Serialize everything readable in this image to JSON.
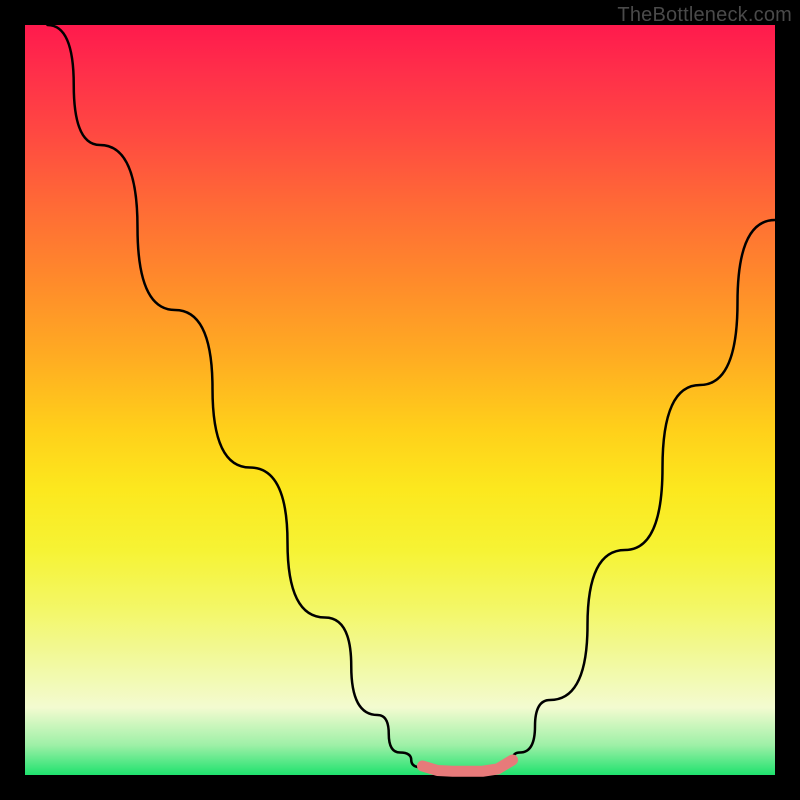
{
  "watermark": "TheBottleneck.com",
  "colors": {
    "background": "#000000",
    "curve": "#000000",
    "highlight": "#e77a7a",
    "gradient_top": "#ff1a4d",
    "gradient_bottom": "#1fe26e"
  },
  "chart_data": {
    "type": "line",
    "title": "",
    "xlabel": "",
    "ylabel": "",
    "xlim": [
      0,
      100
    ],
    "ylim": [
      0,
      100
    ],
    "grid": false,
    "legend": false,
    "series": [
      {
        "name": "bottleneck-curve",
        "x": [
          3,
          10,
          20,
          30,
          40,
          47,
          50,
          53,
          56,
          58,
          60,
          62,
          64,
          66,
          70,
          80,
          90,
          100
        ],
        "y": [
          100,
          84,
          62,
          41,
          21,
          8,
          3,
          1,
          0.5,
          0.5,
          0.5,
          0.5,
          1,
          3,
          10,
          30,
          52,
          74
        ]
      },
      {
        "name": "optimal-zone-highlight",
        "x": [
          53,
          55,
          57,
          59,
          61,
          63,
          65
        ],
        "y": [
          1.2,
          0.6,
          0.5,
          0.5,
          0.5,
          0.8,
          2.0
        ]
      }
    ],
    "annotations": []
  }
}
